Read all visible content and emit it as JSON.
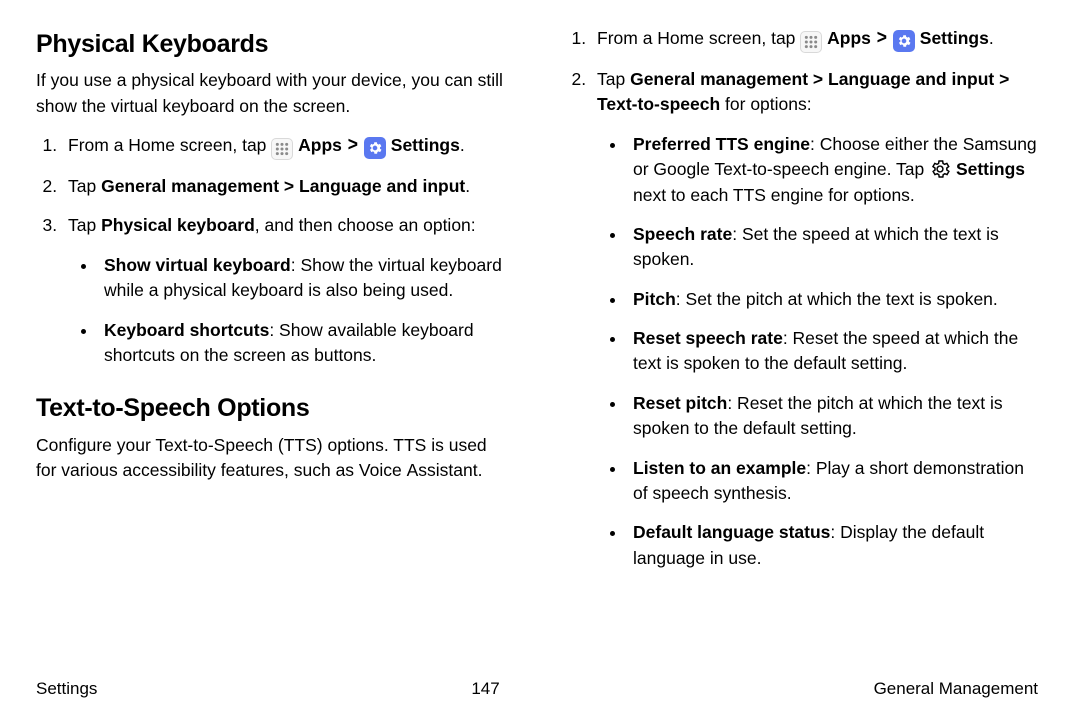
{
  "left": {
    "heading1": "Physical Keyboards",
    "intro1": "If you use a physical keyboard with your device, you can still show the virtual keyboard on the screen.",
    "step1_pre": "From a Home screen, tap ",
    "step1_apps": "Apps",
    "step1_settings": "Settings",
    "step1_dot": ".",
    "step2_pre": "Tap ",
    "step2_bold": "General management > Language and input",
    "step2_dot": ".",
    "step3_pre": "Tap ",
    "step3_bold": "Physical keyboard",
    "step3_post": ", and then choose an option:",
    "opt1_bold": "Show virtual keyboard",
    "opt1_rest": ": Show the virtual keyboard while a physical keyboard is also being used.",
    "opt2_bold": "Keyboard shortcuts",
    "opt2_rest": ": Show available keyboard shortcuts on the screen as buttons.",
    "heading2": "Text-to-Speech Options",
    "intro2": "Configure your Text-to-Speech (TTS) options. TTS is used for various accessibility features, such as Voice Assistant."
  },
  "right": {
    "step1_pre": "From a Home screen, tap ",
    "step1_apps": "Apps",
    "step1_settings": "Settings",
    "step1_dot": ".",
    "step2_pre": "Tap ",
    "step2_bold": "General management > Language and input > Text-to-speech",
    "step2_post": " for options:",
    "b1_bold": "Preferred TTS engine",
    "b1_mid": ": Choose either the Samsung or Google Text-to-speech engine. Tap ",
    "b1_settings": "Settings",
    "b1_end": " next to each TTS engine for options.",
    "b2_bold": "Speech rate",
    "b2_rest": ": Set the speed at which the text is spoken.",
    "b3_bold": "Pitch",
    "b3_rest": ": Set the pitch at which the text is spoken.",
    "b4_bold": "Reset speech rate",
    "b4_rest": ": Reset the speed at which the text is spoken to the default setting.",
    "b5_bold": "Reset pitch",
    "b5_rest": ": Reset the pitch at which the text is spoken to the default setting.",
    "b6_bold": "Listen to an example",
    "b6_rest": ": Play a short demonstration of speech synthesis.",
    "b7_bold": "Default language status",
    "b7_rest": ": Display the default language in use."
  },
  "footer": {
    "left": "Settings",
    "center": "147",
    "right": "General Management"
  },
  "chev": ">"
}
